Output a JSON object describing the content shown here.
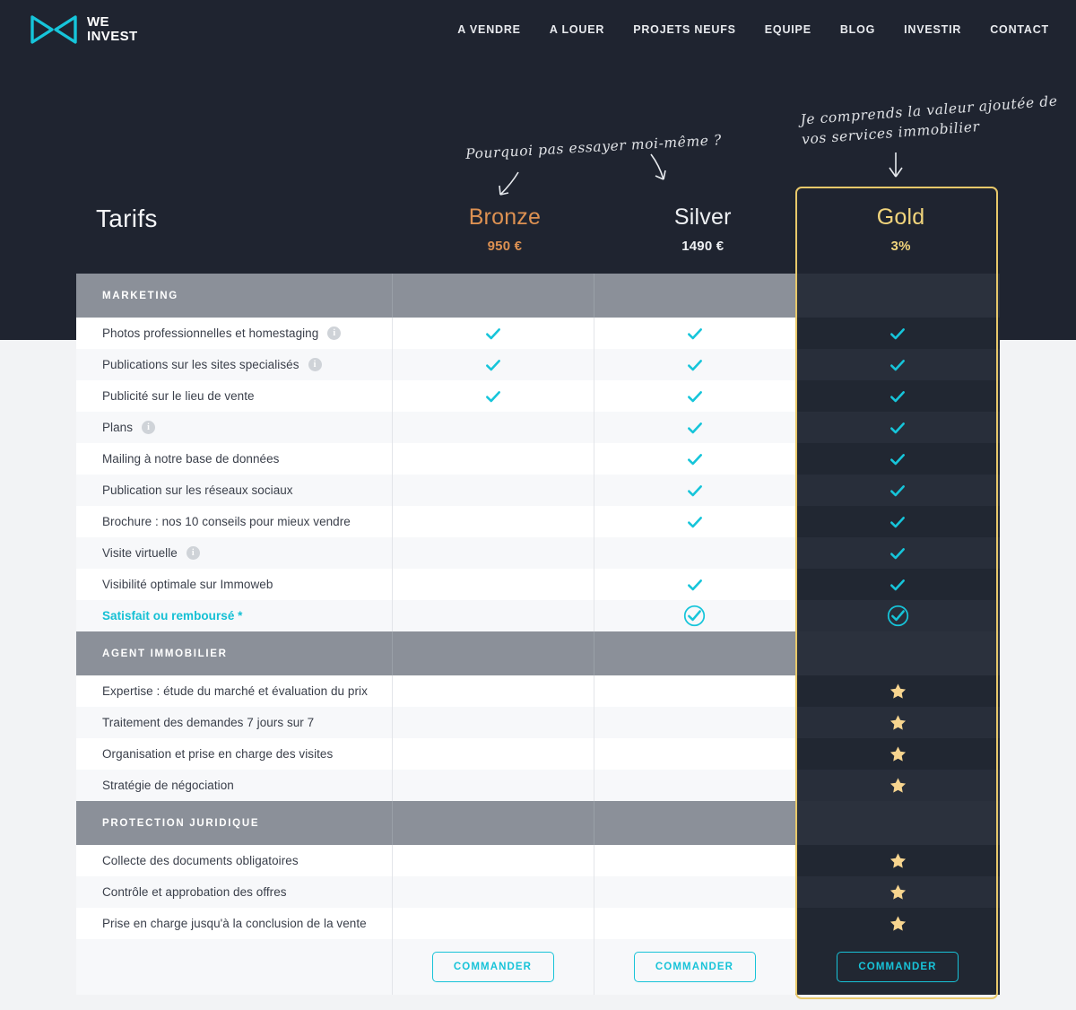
{
  "brand": {
    "line1": "WE",
    "line2": "INVEST",
    "accent": "#16c5da"
  },
  "nav": [
    {
      "label": "A VENDRE"
    },
    {
      "label": "A LOUER"
    },
    {
      "label": "PROJETS NEUFS"
    },
    {
      "label": "EQUIPE"
    },
    {
      "label": "BLOG"
    },
    {
      "label": "INVESTIR"
    },
    {
      "label": "CONTACT"
    }
  ],
  "annotations": {
    "bronze": "Pourquoi pas essayer moi-même ?",
    "gold": "Je comprends la valeur ajoutée de vos services immobilier"
  },
  "table": {
    "title": "Tarifs",
    "plans": [
      {
        "name": "Bronze",
        "price": "950 €",
        "color": "#dd9152",
        "cta": "COMMANDER",
        "highlight": false
      },
      {
        "name": "Silver",
        "price": "1490 €",
        "color": "#eef0f3",
        "cta": "COMMANDER",
        "highlight": false
      },
      {
        "name": "Gold",
        "price": "3%",
        "color": "#f2d57c",
        "cta": "COMMANDER",
        "highlight": true
      }
    ],
    "sections": [
      {
        "title": "MARKETING",
        "rows": [
          {
            "label": "Photos professionnelles et homestaging",
            "info": true,
            "highlight": false,
            "marks": [
              "check",
              "check",
              "check"
            ]
          },
          {
            "label": "Publications sur les sites specialisés",
            "info": true,
            "highlight": false,
            "marks": [
              "check",
              "check",
              "check"
            ]
          },
          {
            "label": "Publicité sur le lieu de vente",
            "info": false,
            "highlight": false,
            "marks": [
              "check",
              "check",
              "check"
            ]
          },
          {
            "label": "Plans",
            "info": true,
            "highlight": false,
            "marks": [
              "",
              "check",
              "check"
            ]
          },
          {
            "label": "Mailing à notre base de données",
            "info": false,
            "highlight": false,
            "marks": [
              "",
              "check",
              "check"
            ]
          },
          {
            "label": "Publication sur les réseaux sociaux",
            "info": false,
            "highlight": false,
            "marks": [
              "",
              "check",
              "check"
            ]
          },
          {
            "label": "Brochure : nos 10 conseils pour mieux vendre",
            "info": false,
            "highlight": false,
            "marks": [
              "",
              "check",
              "check"
            ]
          },
          {
            "label": "Visite virtuelle",
            "info": true,
            "highlight": false,
            "marks": [
              "",
              "",
              "check"
            ]
          },
          {
            "label": "Visibilité optimale sur Immoweb",
            "info": false,
            "highlight": false,
            "marks": [
              "",
              "check",
              "check"
            ]
          },
          {
            "label": "Satisfait ou remboursé *",
            "info": false,
            "highlight": true,
            "marks": [
              "",
              "check-circle",
              "check-circle"
            ]
          }
        ]
      },
      {
        "title": "AGENT IMMOBILIER",
        "rows": [
          {
            "label": "Expertise : étude du marché et évaluation du prix",
            "info": false,
            "highlight": false,
            "marks": [
              "",
              "",
              "star"
            ]
          },
          {
            "label": "Traitement des demandes 7 jours sur 7",
            "info": false,
            "highlight": false,
            "marks": [
              "",
              "",
              "star"
            ]
          },
          {
            "label": "Organisation et prise en charge des visites",
            "info": false,
            "highlight": false,
            "marks": [
              "",
              "",
              "star"
            ]
          },
          {
            "label": "Stratégie de négociation",
            "info": false,
            "highlight": false,
            "marks": [
              "",
              "",
              "star"
            ]
          }
        ]
      },
      {
        "title": "PROTECTION JURIDIQUE",
        "rows": [
          {
            "label": "Collecte des documents obligatoires",
            "info": false,
            "highlight": false,
            "marks": [
              "",
              "",
              "star"
            ]
          },
          {
            "label": "Contrôle et approbation des offres",
            "info": false,
            "highlight": false,
            "marks": [
              "",
              "",
              "star"
            ]
          },
          {
            "label": "Prise en charge jusqu'à la conclusion de la vente",
            "info": false,
            "highlight": false,
            "marks": [
              "",
              "",
              "star"
            ]
          }
        ]
      }
    ]
  }
}
